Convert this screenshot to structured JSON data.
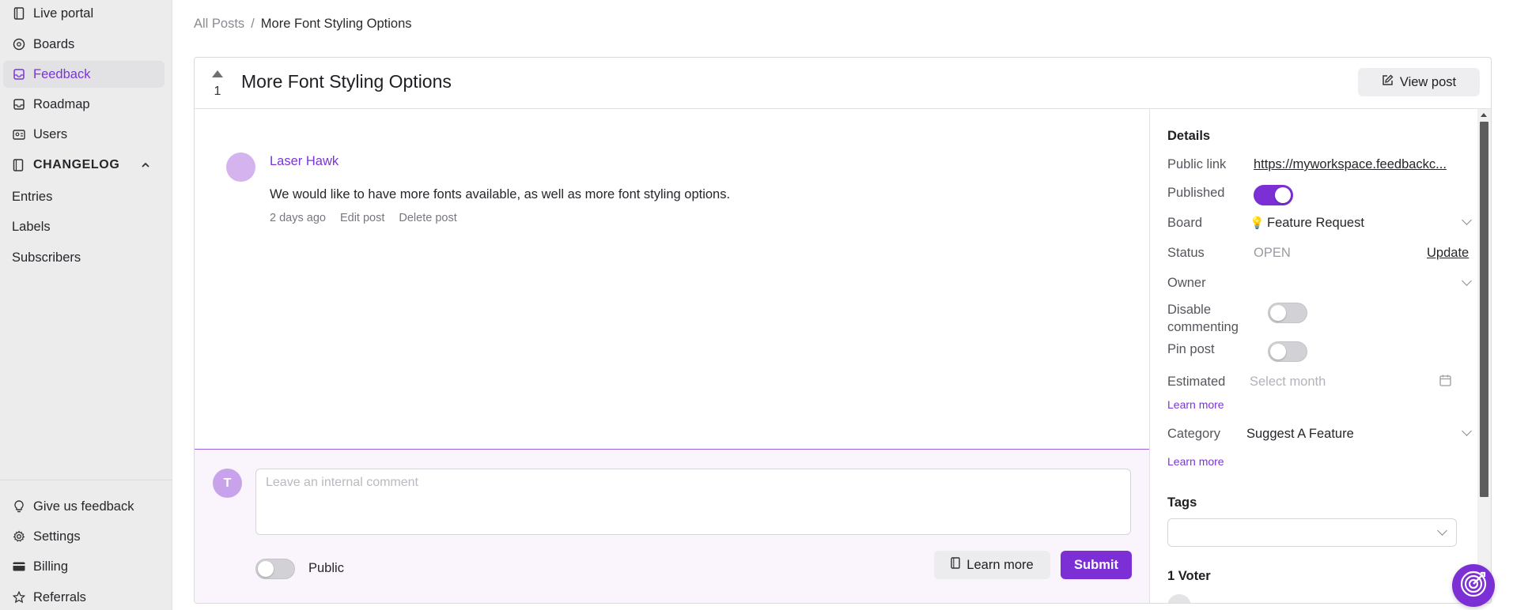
{
  "sidebar": {
    "items": [
      {
        "label": "Live portal",
        "icon": "book-icon"
      },
      {
        "label": "Boards",
        "icon": "boards-icon"
      },
      {
        "label": "Feedback",
        "icon": "inbox-icon",
        "active": true
      },
      {
        "label": "Roadmap",
        "icon": "roadmap-icon"
      },
      {
        "label": "Users",
        "icon": "users-icon"
      }
    ],
    "changelog": {
      "label": "CHANGELOG",
      "items": [
        {
          "label": "Entries"
        },
        {
          "label": "Labels"
        },
        {
          "label": "Subscribers"
        }
      ]
    },
    "bottom": [
      {
        "label": "Give us feedback",
        "icon": "lightbulb-icon"
      },
      {
        "label": "Settings",
        "icon": "gear-icon"
      },
      {
        "label": "Billing",
        "icon": "card-icon"
      },
      {
        "label": "Referrals",
        "icon": "star-icon"
      }
    ]
  },
  "breadcrumb": {
    "root": "All Posts",
    "separator": "/",
    "current": "More Font Styling Options"
  },
  "post": {
    "vote_count": "1",
    "title": "More Font Styling Options",
    "view_post_label": "View post",
    "author": "Laser Hawk",
    "body": "We would like to have more fonts available, as well as more font styling options.",
    "time_ago": "2 days ago",
    "edit_label": "Edit post",
    "delete_label": "Delete post"
  },
  "comment": {
    "avatar_initial": "T",
    "placeholder": "Leave an internal comment",
    "public_label": "Public",
    "public_on": false,
    "learn_more_label": "Learn more",
    "submit_label": "Submit"
  },
  "details": {
    "heading": "Details",
    "public_link_label": "Public link",
    "public_link": "https://myworkspace.feedbackc...",
    "published_label": "Published",
    "published_on": true,
    "board_label": "Board",
    "board_emoji": "💡",
    "board_value": "Feature Request",
    "status_label": "Status",
    "status_value": "OPEN",
    "status_update": "Update",
    "owner_label": "Owner",
    "disable_commenting_label": "Disable commenting",
    "disable_commenting_on": false,
    "pin_post_label": "Pin post",
    "pin_post_on": false,
    "estimated_label": "Estimated",
    "estimated_placeholder": "Select month",
    "learn_more_1": "Learn more",
    "category_label": "Category",
    "category_value": "Suggest A Feature",
    "learn_more_2": "Learn more",
    "tags_label": "Tags",
    "voters_label": "1 Voter"
  },
  "colors": {
    "accent": "#7b2fd5",
    "sidebar_bg": "#ececec",
    "comment_bg": "#faf4fc"
  }
}
